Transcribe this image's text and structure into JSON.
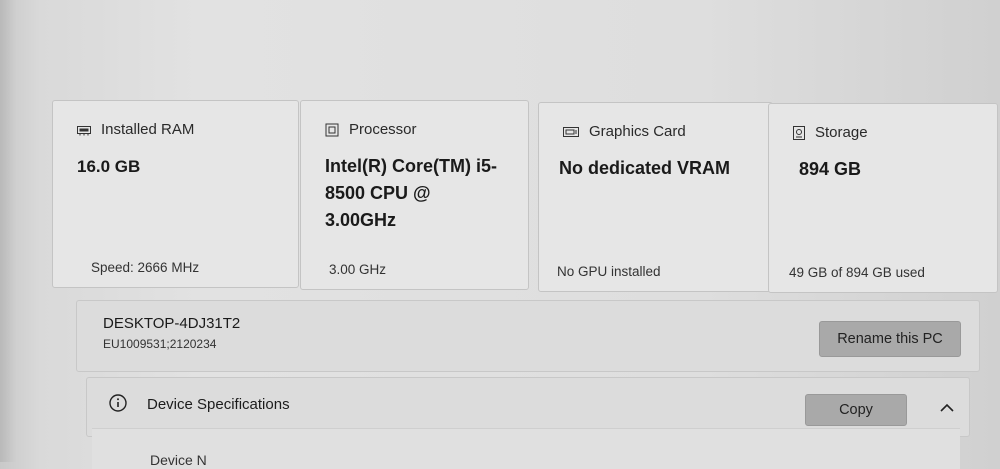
{
  "cards": [
    {
      "icon": "ram-icon",
      "label": "Installed RAM",
      "value": "16.0 GB",
      "sub": "Speed: 2666 MHz"
    },
    {
      "icon": "processor-icon",
      "label": "Processor",
      "value": "Intel(R) Core(TM) i5-8500 CPU @ 3.00GHz",
      "sub": "3.00 GHz"
    },
    {
      "icon": "graphics-card-icon",
      "label": "Graphics Card",
      "value": "No dedicated VRAM",
      "sub": "No GPU installed"
    },
    {
      "icon": "storage-icon",
      "label": "Storage",
      "value": "894 GB",
      "sub": "49 GB of 894 GB used"
    }
  ],
  "pc": {
    "name": "DESKTOP-4DJ31T2",
    "id": "EU1009531;2120234",
    "rename_label": "Rename this PC"
  },
  "specs": {
    "label": "Device Specifications",
    "copy_label": "Copy",
    "next_item_partial": "Device N"
  }
}
